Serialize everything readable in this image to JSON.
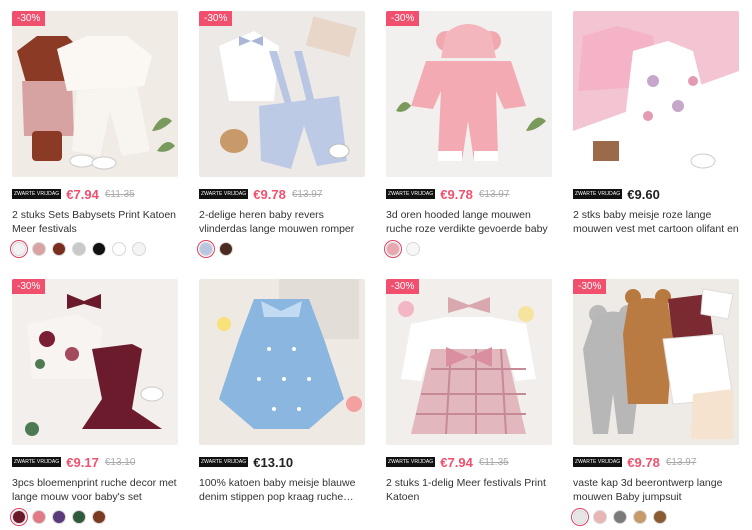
{
  "products": [
    {
      "badge": "-30%",
      "tag": "ZWARTE VRIJDAG",
      "price": "€7.94",
      "old_price": "€11.35",
      "title": "2 stuks Sets Babysets Print Katoen Meer festivals",
      "image_icon": "two-knit-baby-sets-image",
      "swatches": [
        "#f2f2f2",
        "#d9a3a3",
        "#7a2f1e",
        "#c9c9c9",
        "#111111",
        "#ffffff",
        "#f4f4f4"
      ]
    },
    {
      "badge": "-30%",
      "tag": "ZWARTE VRIJDAG",
      "price": "€9.78",
      "old_price": "€13.97",
      "title": "2-delige heren baby revers vlinderdas lange mouwen romper en overall set",
      "image_icon": "bowtie-romper-overall-image",
      "swatches": [
        "#b9c6e0",
        "#4b2b20"
      ]
    },
    {
      "badge": "-30%",
      "tag": "ZWARTE VRIJDAG",
      "price": "€9.78",
      "old_price": "€13.97",
      "title": "3d oren hooded lange mouwen ruche roze verdikte gevoerde baby jumpsuit",
      "image_icon": "pink-hooded-jumpsuit-image",
      "swatches": [
        "#e9a8b0",
        "#f7f7f7"
      ]
    },
    {
      "badge": "",
      "tag": "ZWARTE VRIJDAG",
      "price": "€9.60",
      "old_price": "",
      "title": "2 stks baby meisje roze lange mouwen vest met cartoon olifant en vlinder pr…",
      "image_icon": "pink-cardigan-elephant-dress-image",
      "swatches": []
    },
    {
      "badge": "-30%",
      "tag": "ZWARTE VRIJDAG",
      "price": "€9.17",
      "old_price": "€13.10",
      "title": "3pcs bloemenprint ruche decor met lange mouw voor baby's set",
      "image_icon": "floral-ruffle-set-image",
      "swatches": [
        "#6a1a28",
        "#e07a86",
        "#5b3a7a",
        "#2f5a3c",
        "#7a3b22"
      ]
    },
    {
      "badge": "",
      "tag": "ZWARTE VRIJDAG",
      "price": "€13.10",
      "old_price": "",
      "title": "100% katoen baby meisje blauwe denim stippen pop kraag ruche…",
      "image_icon": "blue-denim-dot-dress-image",
      "swatches": []
    },
    {
      "badge": "-30%",
      "tag": "ZWARTE VRIJDAG",
      "price": "€7.94",
      "old_price": "€11.35",
      "title": "2 stuks 1-delig Meer festivals Print Katoen",
      "image_icon": "plaid-bow-dress-image",
      "swatches": []
    },
    {
      "badge": "-30%",
      "tag": "ZWARTE VRIJDAG",
      "price": "€9.78",
      "old_price": "€13.97",
      "title": "vaste kap 3d beerontwerp lange mouwen Baby jumpsuit",
      "image_icon": "bear-hood-jumpsuits-image",
      "swatches": [
        "#e6e6e6",
        "#e8b6b6",
        "#7a7a7a",
        "#c79a6a",
        "#8a5a32"
      ]
    }
  ]
}
